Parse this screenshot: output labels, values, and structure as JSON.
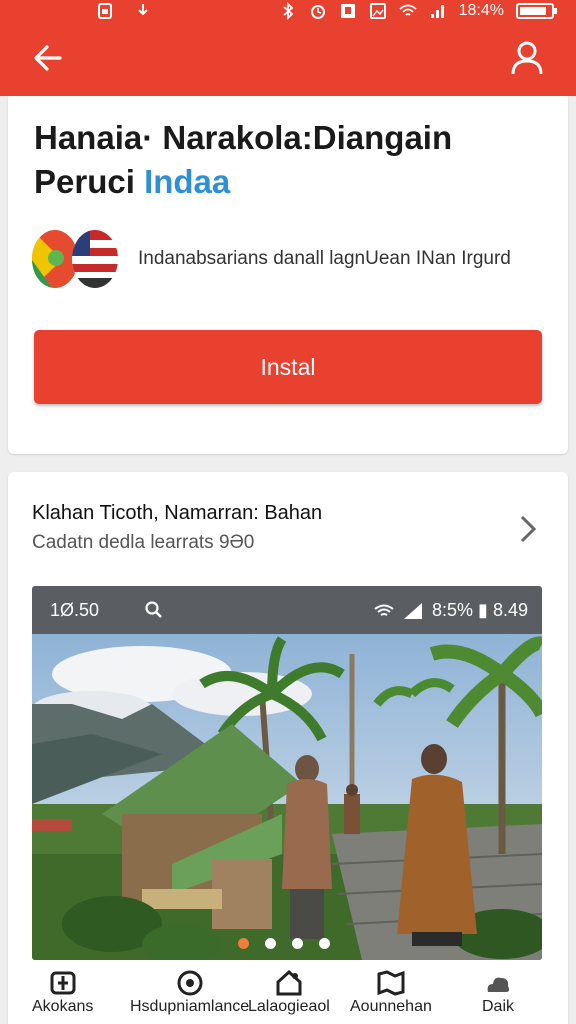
{
  "status_bar": {
    "left_icons": [
      "sim-icon",
      "download-icon"
    ],
    "right_icons": [
      "bluetooth-icon",
      "alarm-icon",
      "notification-icon",
      "image-icon",
      "wifi-icon",
      "signal-icon"
    ],
    "battery_text": "18:4%"
  },
  "app_bar": {
    "back_icon": "arrow-left-icon",
    "account_icon": "user-icon",
    "color": "#e8412f"
  },
  "app": {
    "title_line1": "Hanaia· Narakola:Diangain",
    "title_line2_main": "Peruci",
    "title_line2_accent": "Indaa",
    "accent_color": "#2f8fd6",
    "developer": "Indanabsarians danall lagnUean INan Irgurd",
    "install_label": "Instal"
  },
  "details": {
    "title": "Klahan Ticoth, Namarran: Bahan",
    "subtitle": "Cadatn dedla learrats 9Ə0",
    "chevron_icon": "chevron-right-icon"
  },
  "screenshot": {
    "time": "1Ø.50",
    "search_icon": "search-icon",
    "status_right": "8:5% ▮ 8.49",
    "pager_count": 4,
    "pager_active_index": 0,
    "active_dot_color": "#f07b3a"
  },
  "tabs": [
    {
      "label": "Akokans",
      "icon": "apps-icon"
    },
    {
      "label": "Hsdupniamlance",
      "icon": "target-icon"
    },
    {
      "label": "Lalaogieaol",
      "icon": "home-icon"
    },
    {
      "label": "Aounnehan",
      "icon": "map-icon"
    },
    {
      "label": "Daik",
      "icon": "cloud-icon"
    }
  ]
}
